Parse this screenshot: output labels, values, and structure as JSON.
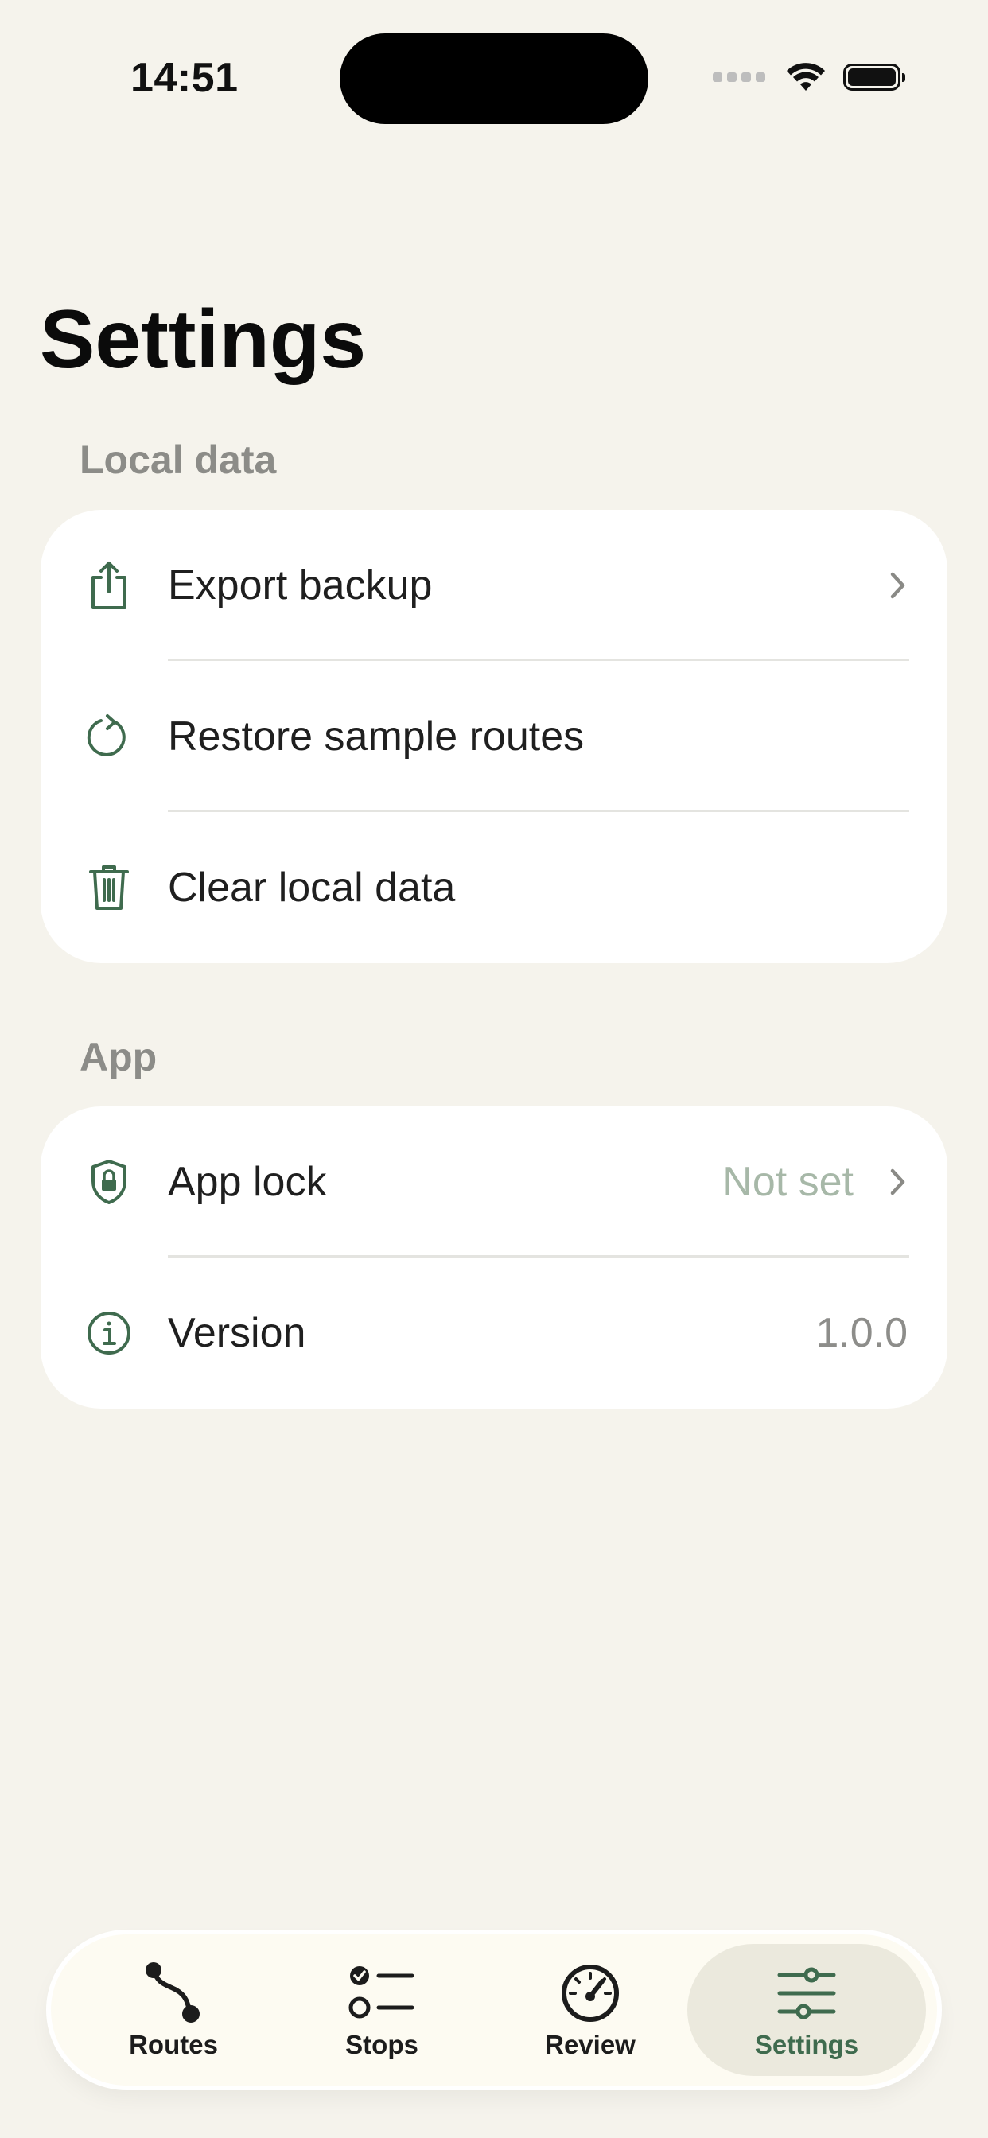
{
  "status_bar": {
    "time": "14:51"
  },
  "page": {
    "title": "Settings"
  },
  "sections": {
    "local_data": {
      "header": "Local data",
      "rows": [
        {
          "label": "Export backup",
          "icon": "share-icon",
          "chevron": true
        },
        {
          "label": "Restore sample routes",
          "icon": "refresh-icon",
          "chevron": false
        },
        {
          "label": "Clear local data",
          "icon": "trash-icon",
          "chevron": false
        }
      ]
    },
    "app": {
      "header": "App",
      "rows": [
        {
          "label": "App lock",
          "value": "Not set",
          "icon": "shield-lock-icon",
          "chevron": true
        },
        {
          "label": "Version",
          "value": "1.0.0",
          "icon": "info-icon",
          "chevron": false
        }
      ]
    }
  },
  "tabbar": {
    "tabs": [
      {
        "label": "Routes",
        "icon": "route-icon",
        "active": false
      },
      {
        "label": "Stops",
        "icon": "checklist-icon",
        "active": false
      },
      {
        "label": "Review",
        "icon": "gauge-icon",
        "active": false
      },
      {
        "label": "Settings",
        "icon": "sliders-icon",
        "active": true
      }
    ]
  },
  "colors": {
    "accent": "#3f6b4e",
    "background": "#f5f3ec",
    "card": "#ffffff",
    "muted_value": "#a7b8a8"
  }
}
